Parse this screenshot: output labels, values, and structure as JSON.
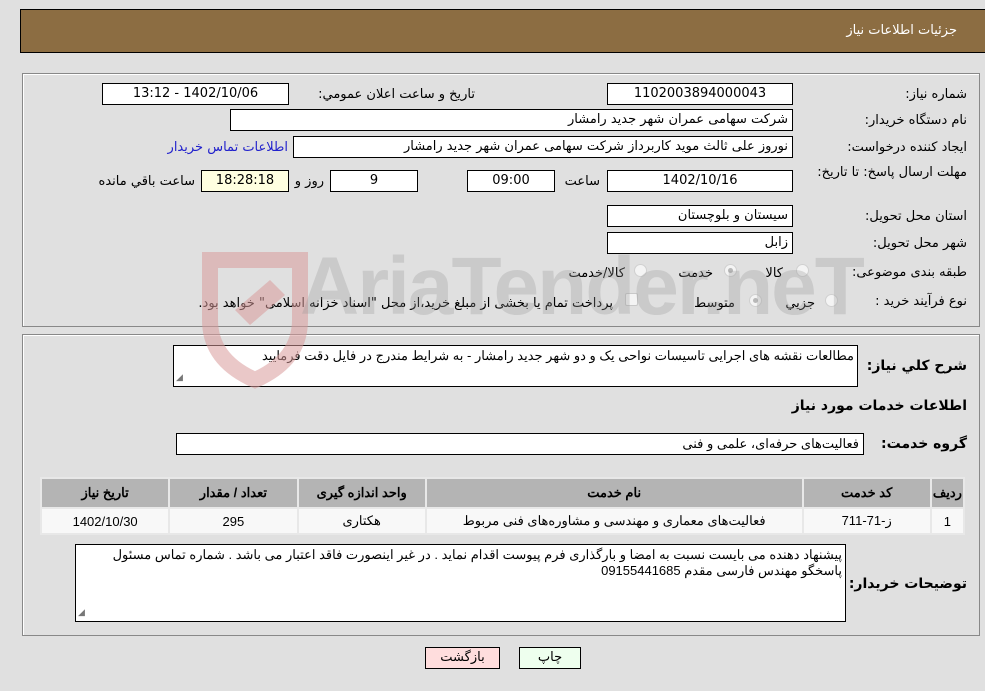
{
  "header": {
    "title": "جزئیات اطلاعات نیاز"
  },
  "details": {
    "need_number": {
      "label": "شماره نیاز:",
      "value": "1102003894000043"
    },
    "announce_datetime": {
      "label": "تاریخ و ساعت اعلان عمومي:",
      "value": "1402/10/06 - 13:12"
    },
    "buyer_org": {
      "label": "نام دستگاه خریدار:",
      "value": "شرکت سهامی عمران شهر جدید رامشار"
    },
    "requester": {
      "label": "ایجاد کننده درخواست:",
      "value": "نوروز علی  ثالث موید کاربرداز شرکت سهامی عمران شهر جدید رامشار"
    },
    "buyer_contact_link": "اطلاعات تماس خریدار",
    "deadline": {
      "label": "مهلت ارسال پاسخ: تا تاریخ:",
      "date": "1402/10/16",
      "time_label": "ساعت",
      "time": "09:00",
      "days": "9",
      "days_label": "روز و",
      "remaining": "18:28:18",
      "remaining_label": "ساعت باقي مانده"
    },
    "province": {
      "label": "استان محل تحویل:",
      "value": "سیستان و بلوچستان"
    },
    "city": {
      "label": "شهر محل تحویل:",
      "value": "زابل"
    },
    "category": {
      "label": "طبقه بندی موضوعی:",
      "options": [
        {
          "label": "کالا",
          "checked": false
        },
        {
          "label": "خدمت",
          "checked": true
        },
        {
          "label": "کالا/خدمت",
          "checked": false
        }
      ]
    },
    "purchase_type": {
      "label": "نوع فرآیند خرید :",
      "options": [
        {
          "label": "جزيي",
          "checked": false
        },
        {
          "label": "متوسط",
          "checked": true
        }
      ],
      "treasury_checkbox_label": "پرداخت تمام یا بخشی از مبلغ خرید،از محل \"اسناد خزانه اسلامی\" خواهد بود.",
      "treasury_checked": false
    }
  },
  "description": {
    "label": "شرح كلي نياز:",
    "value": "مطالعات نقشه های اجرایی تاسیسات نواحی یک و دو شهر جدید رامشار - به  شرایط مندرج در فایل دقت فرمایید"
  },
  "services": {
    "section_title": "اطلاعات خدمات مورد نیاز",
    "group_label": "گروه خدمت:",
    "group_value": "فعالیت‌های حرفه‌ای، علمی و فنی",
    "columns": [
      "ردیف",
      "کد خدمت",
      "نام خدمت",
      "واحد اندازه گیری",
      "تعداد / مقدار",
      "تاریخ نیاز"
    ],
    "rows": [
      [
        "1",
        "ز-71-711",
        "فعالیت‌های معماری و مهندسی و مشاوره‌های فنی مربوط",
        "هکتاری",
        "295",
        "1402/10/30"
      ]
    ]
  },
  "buyer_notes": {
    "label": "توضیحات خریدار:",
    "value": "پیشنهاد دهنده می بایست نسبت به امضا و بارگذاری فرم پیوست اقدام نماید . در غیر اینصورت فاقد اعتبار می باشد . شماره تماس مسئول پاسخگو مهندس فارسی مقدم 09155441685"
  },
  "buttons": {
    "print": "چاپ",
    "back": "بازگشت"
  },
  "watermark": {
    "text": "AriaTender.neT"
  },
  "colors": {
    "header_bg": "#8c6d42",
    "link": "#2222cc",
    "print_bg": "#eeffee",
    "back_bg": "#ffdddd"
  }
}
